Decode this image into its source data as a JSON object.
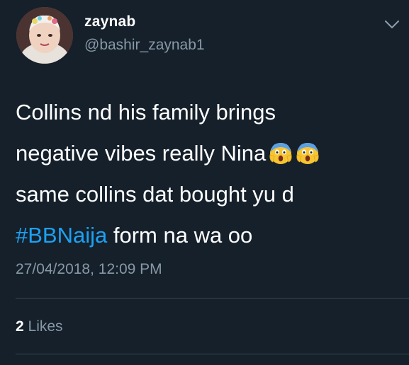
{
  "user": {
    "display_name": "zaynab",
    "handle": "@bashir_zaynab1"
  },
  "tweet": {
    "line1": "Collins nd his family brings",
    "line2": "negative vibes really Nina",
    "line3": "same collins dat bought yu d",
    "hashtag": "#BBNaija",
    "line4_rest": " form na wa oo",
    "emoji_name": "face-screaming-in-fear-emoji",
    "timestamp": "27/04/2018, 12:09 PM"
  },
  "stats": {
    "likes_count": "2",
    "likes_label": " Likes"
  },
  "colors": {
    "background": "#15202b",
    "text": "#ffffff",
    "secondary": "#8899a6",
    "link": "#1da1f2",
    "divider": "#38444d"
  },
  "icons": {
    "chevron": "chevron-down-icon"
  }
}
